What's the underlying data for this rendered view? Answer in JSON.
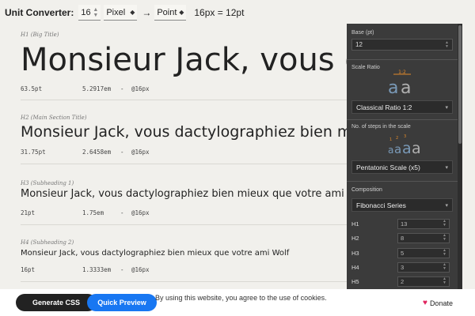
{
  "converter": {
    "label": "Unit Converter:",
    "value": "16",
    "from_unit": "Pixel",
    "arrow": "→",
    "to_unit": "Point",
    "result": "16px = 12pt"
  },
  "specimens": [
    {
      "tag": "H1 (Big Title)",
      "text": "Monsieur Jack, vous dactylographiez bien mieux que votre ami Wolf",
      "pt": "63.5pt",
      "em": "5.2917em",
      "sep": "-",
      "px": "@16px"
    },
    {
      "tag": "H2 (Main Section Title)",
      "text": "Monsieur Jack, vous dactylographiez bien mieux que votre ami Wolf",
      "pt": "31.75pt",
      "em": "2.6458em",
      "sep": "-",
      "px": "@16px"
    },
    {
      "tag": "H3 (Subheading 1)",
      "text": "Monsieur Jack, vous dactylographiez bien mieux que votre ami Wolf",
      "pt": "21pt",
      "em": "1.75em",
      "sep": "-",
      "px": "@16px"
    },
    {
      "tag": "H4 (Subheading 2)",
      "text": "Monsieur Jack, vous dactylographiez bien mieux que votre ami Wolf",
      "pt": "16pt",
      "em": "1.3333em",
      "sep": "-",
      "px": "@16px"
    }
  ],
  "panel": {
    "base_label": "Base (pt)",
    "base_value": "12",
    "scale_ratio_label": "Scale Ratio",
    "ratio_badge": "1:2",
    "scale_ratio_value": "Classical Ratio 1:2",
    "steps_label": "No. of steps in the scale",
    "steps_value": "Pentatonic Scale (x5)",
    "composition_label": "Composition",
    "composition_value": "Fibonacci Series",
    "headings": [
      {
        "label": "H1",
        "value": "13"
      },
      {
        "label": "H2",
        "value": "8"
      },
      {
        "label": "H3",
        "value": "5"
      },
      {
        "label": "H4",
        "value": "3"
      },
      {
        "label": "H5",
        "value": "2"
      }
    ]
  },
  "footer": {
    "generate_label": "Generate CSS",
    "preview_label": "Quick Preview",
    "cookie_text": "By using this website, you agree to the use of cookies.",
    "donate_label": "Donate"
  },
  "colors": {
    "page_bg": "#f1f0ec",
    "panel_bg": "#3b3b3b",
    "accent_blue": "#1877f2",
    "heart": "#e0245e"
  }
}
